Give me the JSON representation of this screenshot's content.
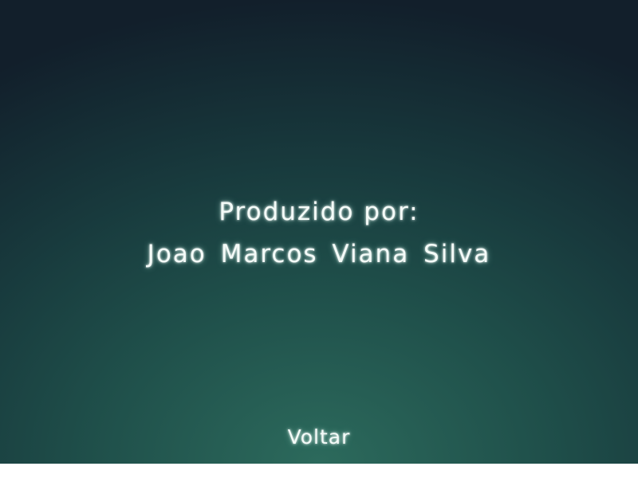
{
  "credits": {
    "heading": "Produzido por:",
    "author": "Joao Marcos Viana Silva"
  },
  "navigation": {
    "back_label": "Voltar"
  },
  "colors": {
    "background_top": "#121f2b",
    "background_glow": "#2c6a5c",
    "text": "#f4fbf8"
  }
}
